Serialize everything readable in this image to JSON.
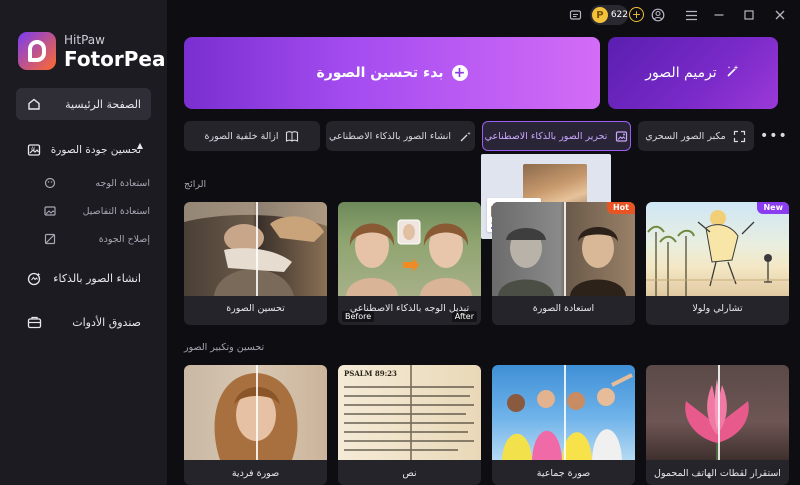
{
  "app": {
    "name_small": "HitPaw",
    "name_big": "FotorPea"
  },
  "titlebar": {
    "credits": "622"
  },
  "sidebar": {
    "home": "الصفحة الرئيسية",
    "enhance": "تحسين جودة الصورة",
    "sub_face": "استعادة الوجه",
    "sub_details": "استعادة التفاصيل",
    "sub_quality": "إصلاح الجودة",
    "ai_create": "انشاء الصور بالذكاء",
    "toolbox": "صندوق الأدوات"
  },
  "hero": {
    "start_label": "بدء تحسين الصورة",
    "restore_label": "ترميم الصور"
  },
  "chips": {
    "enlarger": "مكبر الصور السحري",
    "ai_edit": "تحرير الصور بالذكاء الاصطناعي",
    "ai_create": "انشاء الصور بالذكاء الاصطناعي",
    "remove_bg": "ازالة خلفية الصورة"
  },
  "sections": {
    "popular": "الرائج",
    "enhance_enlarge": "تحسين وتكبير الصور"
  },
  "cards_top": [
    {
      "caption": "تشارلي ولولا",
      "badge": "New"
    },
    {
      "caption": "استعادة الصورة",
      "badge": "Hot"
    },
    {
      "caption": "تبديل الوجه بالذكاء الاصطناعي",
      "before": "Before",
      "after": "After"
    },
    {
      "caption": "تحسين الصورة"
    }
  ],
  "cards_bottom": [
    {
      "caption": "استقرار لقطات الهاتف المحمول"
    },
    {
      "caption": "صورة جماعية"
    },
    {
      "caption": "نص",
      "psalm": "PSALM 89:23"
    },
    {
      "caption": "صورة فردية"
    }
  ],
  "colors": {
    "accent": "#9a5ef2",
    "hot": "#e95425",
    "new": "#8a3cf0",
    "coin": "#f3c23a"
  }
}
